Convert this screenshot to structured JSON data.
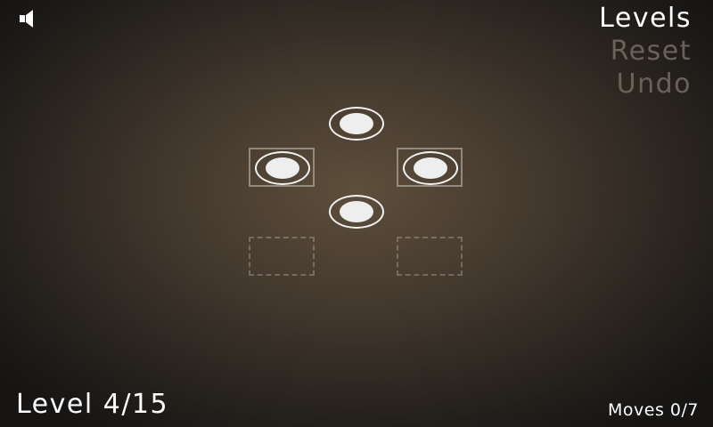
{
  "icons": {
    "sound": "speaker-icon"
  },
  "menu": {
    "levels": "Levels",
    "reset": "Reset",
    "undo": "Undo"
  },
  "status": {
    "level": "Level 4/15",
    "moves": "Moves 0/7"
  },
  "colors": {
    "background_center": "#5e4e3b",
    "background_edge": "#161514",
    "active_text": "#ffffff",
    "disabled_text": "#6a6158",
    "piece": "#f2f2f2"
  }
}
